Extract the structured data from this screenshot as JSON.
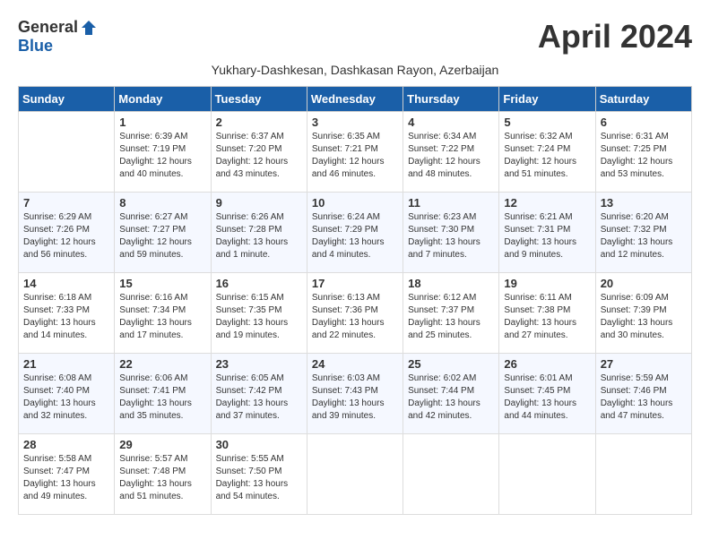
{
  "header": {
    "logo_general": "General",
    "logo_blue": "Blue",
    "month_title": "April 2024",
    "location": "Yukhary-Dashkesan, Dashkasan Rayon, Azerbaijan"
  },
  "columns": [
    "Sunday",
    "Monday",
    "Tuesday",
    "Wednesday",
    "Thursday",
    "Friday",
    "Saturday"
  ],
  "weeks": [
    [
      {
        "day": "",
        "info": ""
      },
      {
        "day": "1",
        "info": "Sunrise: 6:39 AM\nSunset: 7:19 PM\nDaylight: 12 hours\nand 40 minutes."
      },
      {
        "day": "2",
        "info": "Sunrise: 6:37 AM\nSunset: 7:20 PM\nDaylight: 12 hours\nand 43 minutes."
      },
      {
        "day": "3",
        "info": "Sunrise: 6:35 AM\nSunset: 7:21 PM\nDaylight: 12 hours\nand 46 minutes."
      },
      {
        "day": "4",
        "info": "Sunrise: 6:34 AM\nSunset: 7:22 PM\nDaylight: 12 hours\nand 48 minutes."
      },
      {
        "day": "5",
        "info": "Sunrise: 6:32 AM\nSunset: 7:24 PM\nDaylight: 12 hours\nand 51 minutes."
      },
      {
        "day": "6",
        "info": "Sunrise: 6:31 AM\nSunset: 7:25 PM\nDaylight: 12 hours\nand 53 minutes."
      }
    ],
    [
      {
        "day": "7",
        "info": "Sunrise: 6:29 AM\nSunset: 7:26 PM\nDaylight: 12 hours\nand 56 minutes."
      },
      {
        "day": "8",
        "info": "Sunrise: 6:27 AM\nSunset: 7:27 PM\nDaylight: 12 hours\nand 59 minutes."
      },
      {
        "day": "9",
        "info": "Sunrise: 6:26 AM\nSunset: 7:28 PM\nDaylight: 13 hours\nand 1 minute."
      },
      {
        "day": "10",
        "info": "Sunrise: 6:24 AM\nSunset: 7:29 PM\nDaylight: 13 hours\nand 4 minutes."
      },
      {
        "day": "11",
        "info": "Sunrise: 6:23 AM\nSunset: 7:30 PM\nDaylight: 13 hours\nand 7 minutes."
      },
      {
        "day": "12",
        "info": "Sunrise: 6:21 AM\nSunset: 7:31 PM\nDaylight: 13 hours\nand 9 minutes."
      },
      {
        "day": "13",
        "info": "Sunrise: 6:20 AM\nSunset: 7:32 PM\nDaylight: 13 hours\nand 12 minutes."
      }
    ],
    [
      {
        "day": "14",
        "info": "Sunrise: 6:18 AM\nSunset: 7:33 PM\nDaylight: 13 hours\nand 14 minutes."
      },
      {
        "day": "15",
        "info": "Sunrise: 6:16 AM\nSunset: 7:34 PM\nDaylight: 13 hours\nand 17 minutes."
      },
      {
        "day": "16",
        "info": "Sunrise: 6:15 AM\nSunset: 7:35 PM\nDaylight: 13 hours\nand 19 minutes."
      },
      {
        "day": "17",
        "info": "Sunrise: 6:13 AM\nSunset: 7:36 PM\nDaylight: 13 hours\nand 22 minutes."
      },
      {
        "day": "18",
        "info": "Sunrise: 6:12 AM\nSunset: 7:37 PM\nDaylight: 13 hours\nand 25 minutes."
      },
      {
        "day": "19",
        "info": "Sunrise: 6:11 AM\nSunset: 7:38 PM\nDaylight: 13 hours\nand 27 minutes."
      },
      {
        "day": "20",
        "info": "Sunrise: 6:09 AM\nSunset: 7:39 PM\nDaylight: 13 hours\nand 30 minutes."
      }
    ],
    [
      {
        "day": "21",
        "info": "Sunrise: 6:08 AM\nSunset: 7:40 PM\nDaylight: 13 hours\nand 32 minutes."
      },
      {
        "day": "22",
        "info": "Sunrise: 6:06 AM\nSunset: 7:41 PM\nDaylight: 13 hours\nand 35 minutes."
      },
      {
        "day": "23",
        "info": "Sunrise: 6:05 AM\nSunset: 7:42 PM\nDaylight: 13 hours\nand 37 minutes."
      },
      {
        "day": "24",
        "info": "Sunrise: 6:03 AM\nSunset: 7:43 PM\nDaylight: 13 hours\nand 39 minutes."
      },
      {
        "day": "25",
        "info": "Sunrise: 6:02 AM\nSunset: 7:44 PM\nDaylight: 13 hours\nand 42 minutes."
      },
      {
        "day": "26",
        "info": "Sunrise: 6:01 AM\nSunset: 7:45 PM\nDaylight: 13 hours\nand 44 minutes."
      },
      {
        "day": "27",
        "info": "Sunrise: 5:59 AM\nSunset: 7:46 PM\nDaylight: 13 hours\nand 47 minutes."
      }
    ],
    [
      {
        "day": "28",
        "info": "Sunrise: 5:58 AM\nSunset: 7:47 PM\nDaylight: 13 hours\nand 49 minutes."
      },
      {
        "day": "29",
        "info": "Sunrise: 5:57 AM\nSunset: 7:48 PM\nDaylight: 13 hours\nand 51 minutes."
      },
      {
        "day": "30",
        "info": "Sunrise: 5:55 AM\nSunset: 7:50 PM\nDaylight: 13 hours\nand 54 minutes."
      },
      {
        "day": "",
        "info": ""
      },
      {
        "day": "",
        "info": ""
      },
      {
        "day": "",
        "info": ""
      },
      {
        "day": "",
        "info": ""
      }
    ]
  ]
}
